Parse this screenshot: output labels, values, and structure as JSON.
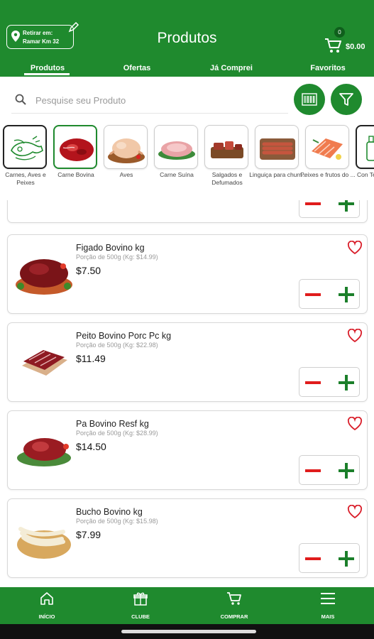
{
  "header": {
    "pickup_line1": "Retirar em:",
    "pickup_line2": "Ramar Km 32",
    "title": "Produtos",
    "cart_count": "0",
    "cart_total": "$0.00"
  },
  "tabs": [
    {
      "label": "Produtos",
      "active": true
    },
    {
      "label": "Ofertas"
    },
    {
      "label": "Já Comprei"
    },
    {
      "label": "Favoritos"
    }
  ],
  "search": {
    "placeholder": "Pesquise seu Produto"
  },
  "categories": [
    {
      "label": "Carnes, Aves e Peixes",
      "icon": "meat-poultry-fish-icon"
    },
    {
      "label": "Carne Bovina",
      "icon": "beef-icon",
      "selected": true
    },
    {
      "label": "Aves",
      "icon": "chicken-icon"
    },
    {
      "label": "Carne Suína",
      "icon": "pork-icon"
    },
    {
      "label": "Salgados e Defumados",
      "icon": "smoked-meat-icon"
    },
    {
      "label": "Linguiça para churr...",
      "icon": "sausage-icon"
    },
    {
      "label": "Peixes e frutos do ...",
      "icon": "fish-icon"
    },
    {
      "label": "Con Ter",
      "icon": "condiment-icon"
    }
  ],
  "products": [
    {
      "name": "Figado Bovino  kg",
      "portion": "Porção de 500g (Kg: $14.99)",
      "price": "$7.50",
      "image": "beef-liver-image"
    },
    {
      "name": "Peito Bovino Porc Pc kg",
      "portion": "Porção de 500g (Kg: $22.98)",
      "price": "$11.49",
      "image": "beef-brisket-image"
    },
    {
      "name": "Pa Bovino Resf kg",
      "portion": "Porção de 500g (Kg: $28.99)",
      "price": "$14.50",
      "image": "beef-shoulder-image"
    },
    {
      "name": "Bucho Bovino kg",
      "portion": "Porção de 500g (Kg: $15.98)",
      "price": "$7.99",
      "image": "beef-tripe-image"
    }
  ],
  "bottom_nav": [
    {
      "label": "INÍCIO",
      "icon": "home-icon"
    },
    {
      "label": "CLUBE",
      "icon": "gift-icon"
    },
    {
      "label": "COMPRAR",
      "icon": "cart-icon"
    },
    {
      "label": "MAIS",
      "icon": "menu-icon"
    }
  ],
  "colors": {
    "brand_green": "#1f8a2e",
    "minus_red": "#e01c1c",
    "plus_green": "#1b7f2a"
  }
}
